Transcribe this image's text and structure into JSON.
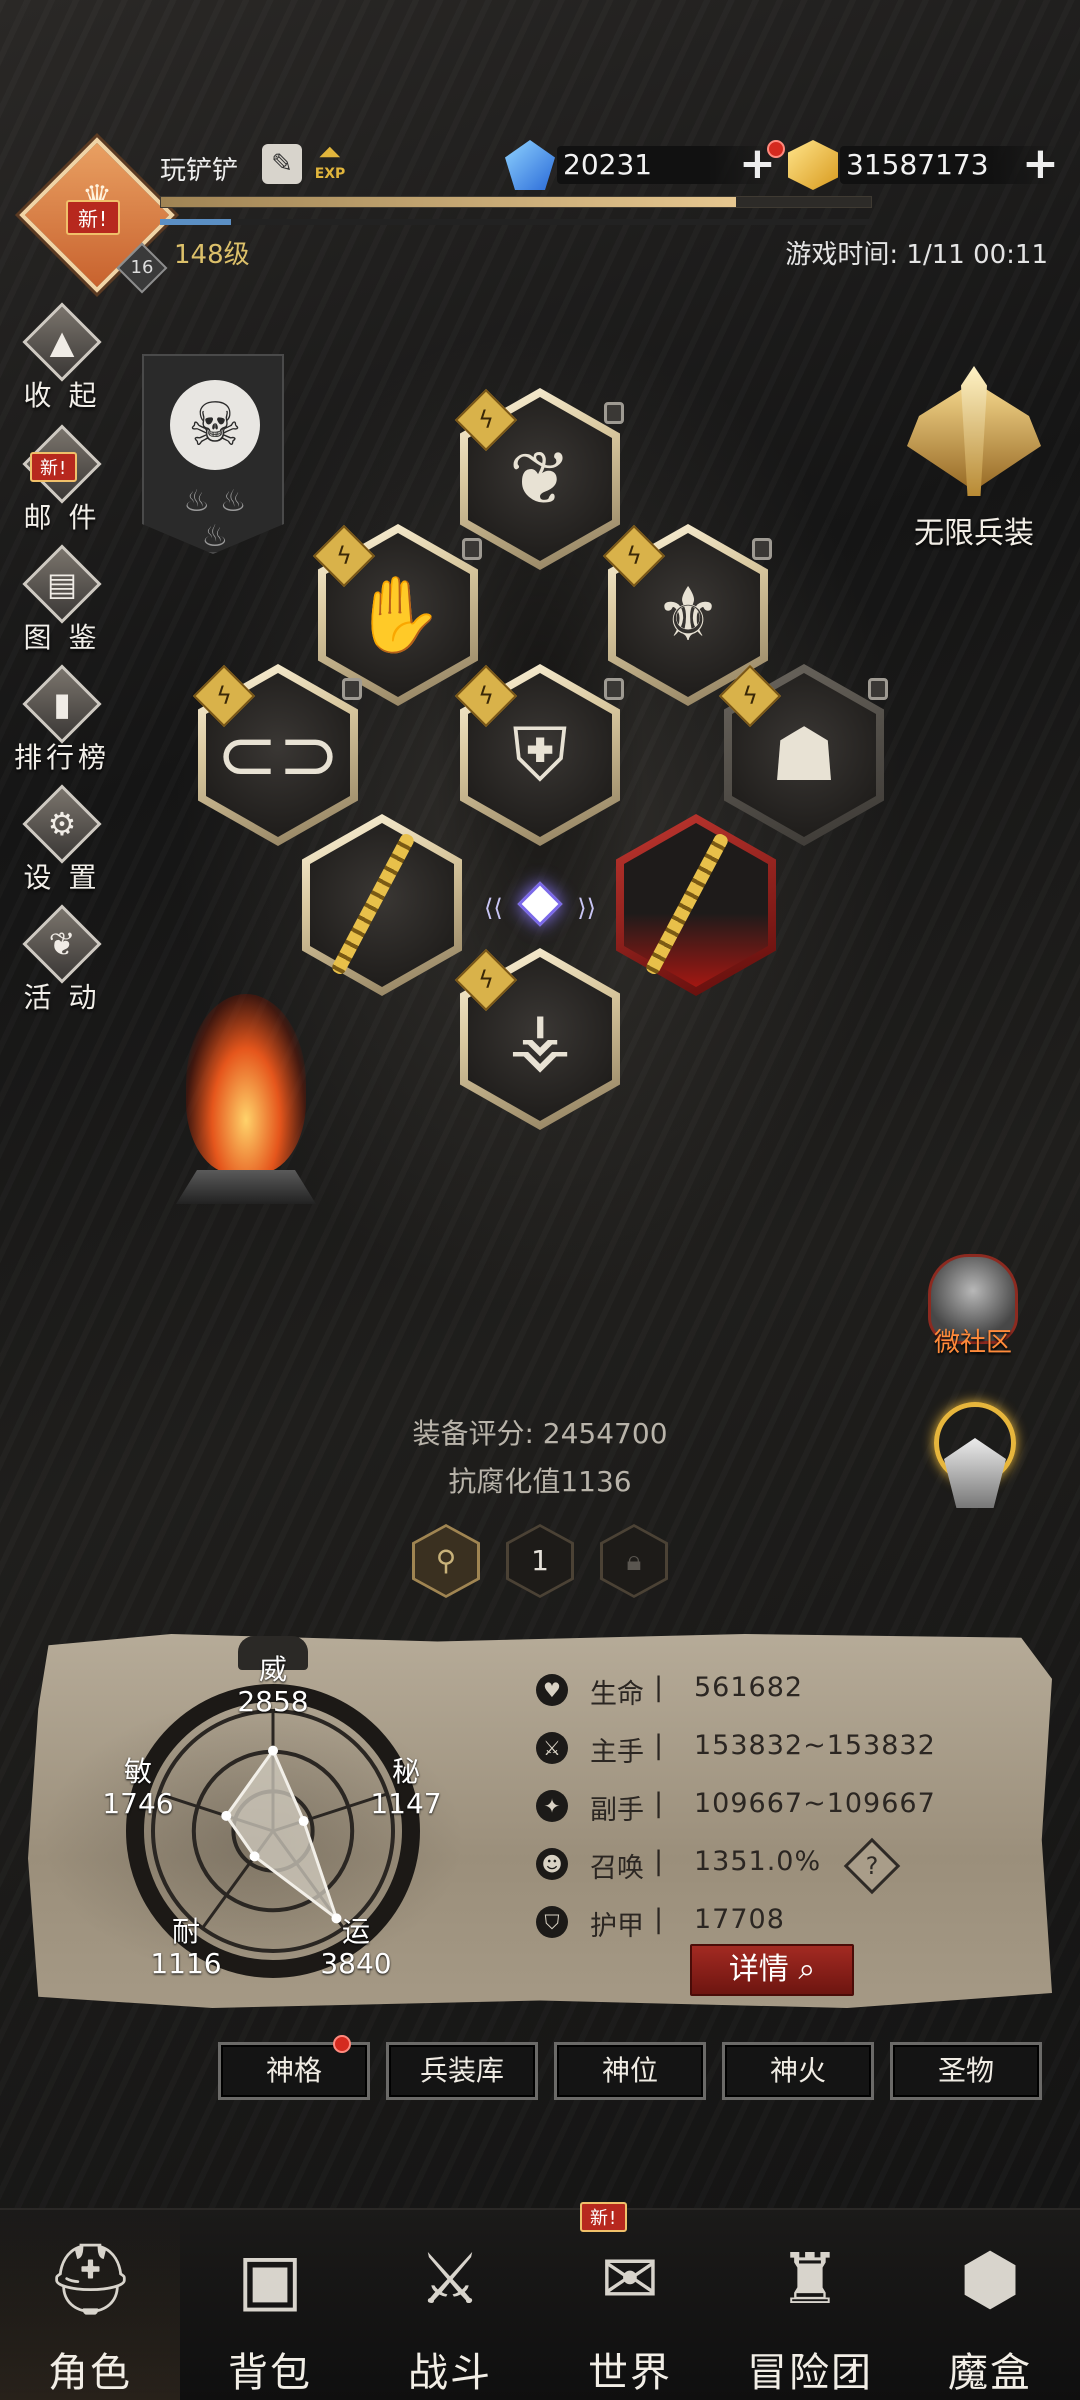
{
  "player": {
    "name": "玩铲铲",
    "level_label": "148级",
    "rank_badge": "16",
    "new_label": "新!",
    "exp_label": "EXP",
    "exp_progress": 0.81,
    "secondary_progress": 0.1
  },
  "currencies": {
    "diamonds": "20231",
    "gold": "31587173"
  },
  "game_time": "游戏时间: 1/11 00:11",
  "side_menu": [
    {
      "label": "收 起",
      "icon": "collapse-icon"
    },
    {
      "label": "邮 件",
      "icon": "mail-icon",
      "badge": "新!"
    },
    {
      "label": "图 鉴",
      "icon": "book-icon"
    },
    {
      "label": "排行榜",
      "icon": "leaderboard-icon"
    },
    {
      "label": "设 置",
      "icon": "gear-icon"
    },
    {
      "label": "活 动",
      "icon": "event-icon"
    }
  ],
  "infinite_gear": {
    "label": "无限兵装"
  },
  "community": {
    "label": "微社区"
  },
  "equipment_score": "装备评分: 2454700",
  "corruption_resist": "抗腐化值1136",
  "slot_pages": {
    "active": "1"
  },
  "attributes": [
    {
      "name": "威",
      "value": "2858"
    },
    {
      "name": "秘",
      "value": "1147"
    },
    {
      "name": "运",
      "value": "3840"
    },
    {
      "name": "耐",
      "value": "1116"
    },
    {
      "name": "敏",
      "value": "1746"
    }
  ],
  "stats": [
    {
      "name": "生命",
      "sep": "|",
      "value": "561682",
      "icon": "heart-icon"
    },
    {
      "name": "主手",
      "sep": "|",
      "value": "153832~153832",
      "icon": "sword-icon"
    },
    {
      "name": "副手",
      "sep": "|",
      "value": "109667~109667",
      "icon": "offhand-icon"
    },
    {
      "name": "召唤",
      "sep": "|",
      "value": "1351.0%",
      "icon": "summon-icon"
    },
    {
      "name": "护甲",
      "sep": "|",
      "value": "17708",
      "icon": "armor-icon"
    }
  ],
  "help_label": "?",
  "detail_button": "详情",
  "sub_tabs": [
    "神格",
    "兵装库",
    "神位",
    "神火",
    "圣物"
  ],
  "bottom_nav": [
    {
      "label": "角色",
      "icon": "helmet-icon"
    },
    {
      "label": "背包",
      "icon": "backpack-icon"
    },
    {
      "label": "战斗",
      "icon": "shield-swords-icon"
    },
    {
      "label": "世界",
      "icon": "scroll-map-icon",
      "badge": "新!"
    },
    {
      "label": "冒险团",
      "icon": "castle-icon"
    },
    {
      "label": "魔盒",
      "icon": "magic-box-icon"
    }
  ],
  "colors": {
    "gold_accent": "#dcc06a",
    "red_badge": "#b7281e",
    "community_orange": "#ff8a3a"
  }
}
